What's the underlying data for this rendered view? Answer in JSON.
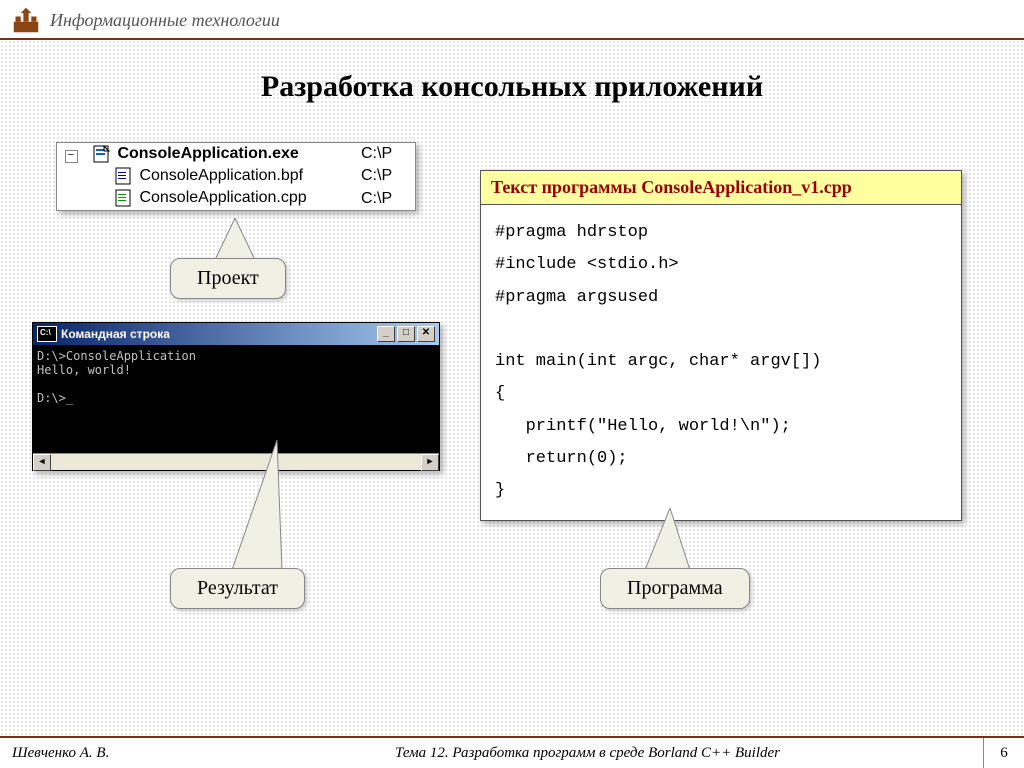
{
  "header": {
    "title": "Информационные технологии"
  },
  "slide_title": "Разработка консольных приложений",
  "project_tree": {
    "items": [
      {
        "name": "ConsoleApplication.exe",
        "path": "C:\\P",
        "bold": true
      },
      {
        "name": "ConsoleApplication.bpf",
        "path": "C:\\P",
        "bold": false
      },
      {
        "name": "ConsoleApplication.cpp",
        "path": "C:\\P",
        "bold": false
      }
    ]
  },
  "callouts": {
    "project": "Проект",
    "result": "Результат",
    "program": "Программа"
  },
  "console": {
    "icon_text": "C:\\",
    "title": "Командная строка",
    "output": "D:\\>ConsoleApplication\nHello, world!\n\nD:\\>_"
  },
  "code_panel": {
    "header": "Текст программы ConsoleApplication_v1.cpp",
    "code": "#pragma hdrstop\n#include <stdio.h>\n#pragma argsused\n\nint main(int argc, char* argv[])\n{\n   printf(\"Hello, world!\\n\");\n   return(0);\n}"
  },
  "footer": {
    "author": "Шевченко А. В.",
    "topic": "Тема 12. Разработка программ в среде Borland C++ Builder",
    "page": "6"
  }
}
